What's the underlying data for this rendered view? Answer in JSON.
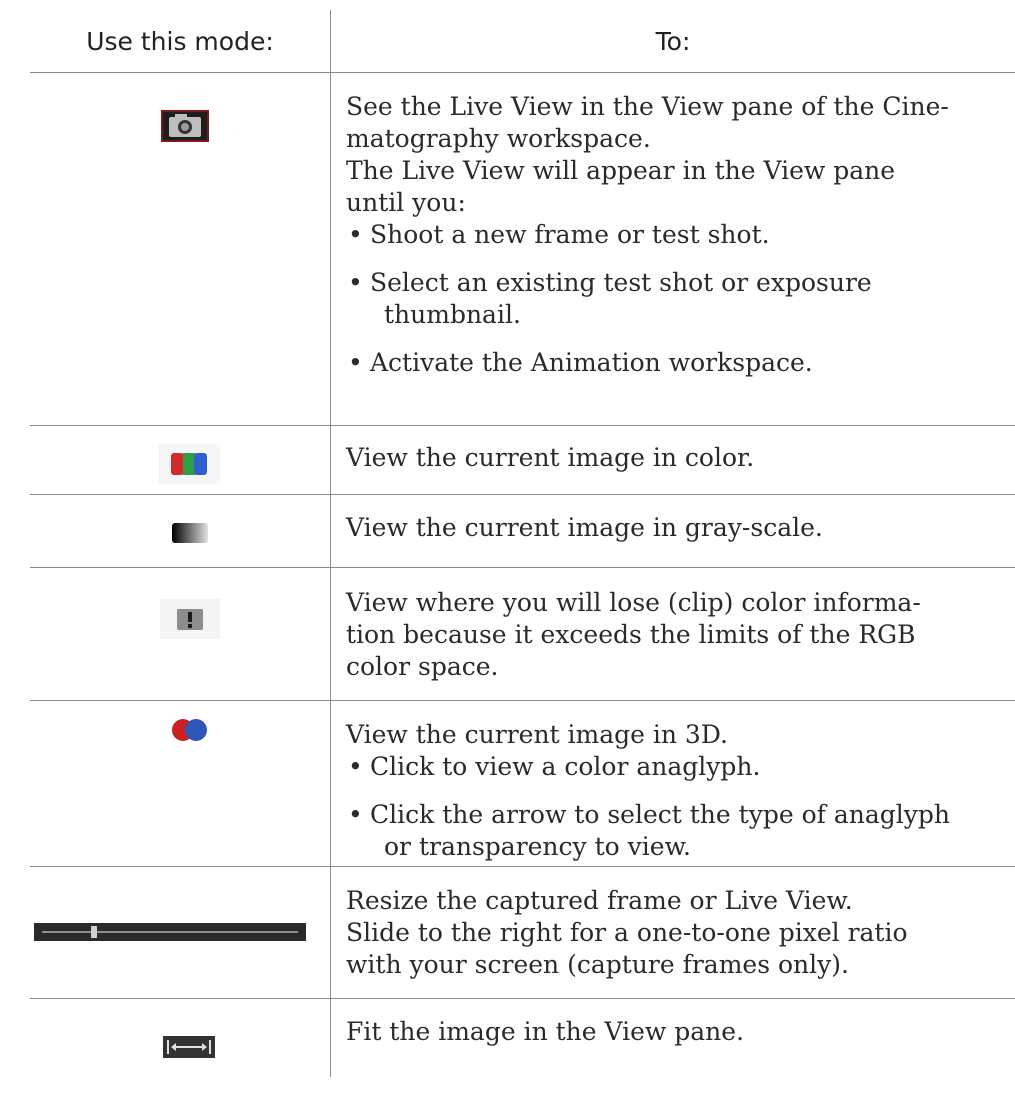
{
  "table": {
    "header": {
      "mode": "Use this mode:",
      "purpose": "To:"
    },
    "rows": [
      {
        "icon": "camera-live-view-icon",
        "lines": [
          "See the Live View in the View pane of the Cine-",
          "matography workspace.",
          "The Live View will appear in the View pane",
          "until you:"
        ],
        "bullets": [
          {
            "lines": [
              "Shoot a new frame or test shot."
            ]
          },
          {
            "lines": [
              "Select an existing test shot or exposure",
              "thumbnail."
            ]
          },
          {
            "lines": [
              "Activate the Animation workspace."
            ]
          }
        ]
      },
      {
        "icon": "rgb-color-icon",
        "lines": [
          "View the current image in color."
        ]
      },
      {
        "icon": "grayscale-gradient-icon",
        "lines": [
          "View the current image in gray-scale."
        ]
      },
      {
        "icon": "clip-warning-icon",
        "lines": [
          "View where you will lose (clip) color informa-",
          "tion because it exceeds the limits of the RGB",
          "color space."
        ]
      },
      {
        "icon": "anaglyph-3d-icon",
        "lines": [
          "View the current image in 3D."
        ],
        "bullets": [
          {
            "lines": [
              "Click to view a color anaglyph."
            ]
          },
          {
            "lines": [
              "Click the arrow to select the type of anaglyph",
              "or transparency to view."
            ]
          }
        ]
      },
      {
        "icon": "zoom-slider-icon",
        "lines": [
          "Resize the captured frame or Live View.",
          "Slide to the right for a one-to-one pixel ratio",
          "with your screen (capture frames only)."
        ]
      },
      {
        "icon": "fit-to-pane-icon",
        "lines": [
          "Fit the image in the View pane."
        ]
      }
    ]
  },
  "colors": {
    "rule": "#8a8a8a",
    "text": "#2a2a2a",
    "icon_red": "#d22b2b",
    "icon_green": "#2ea043",
    "icon_blue": "#2f5fd0"
  }
}
